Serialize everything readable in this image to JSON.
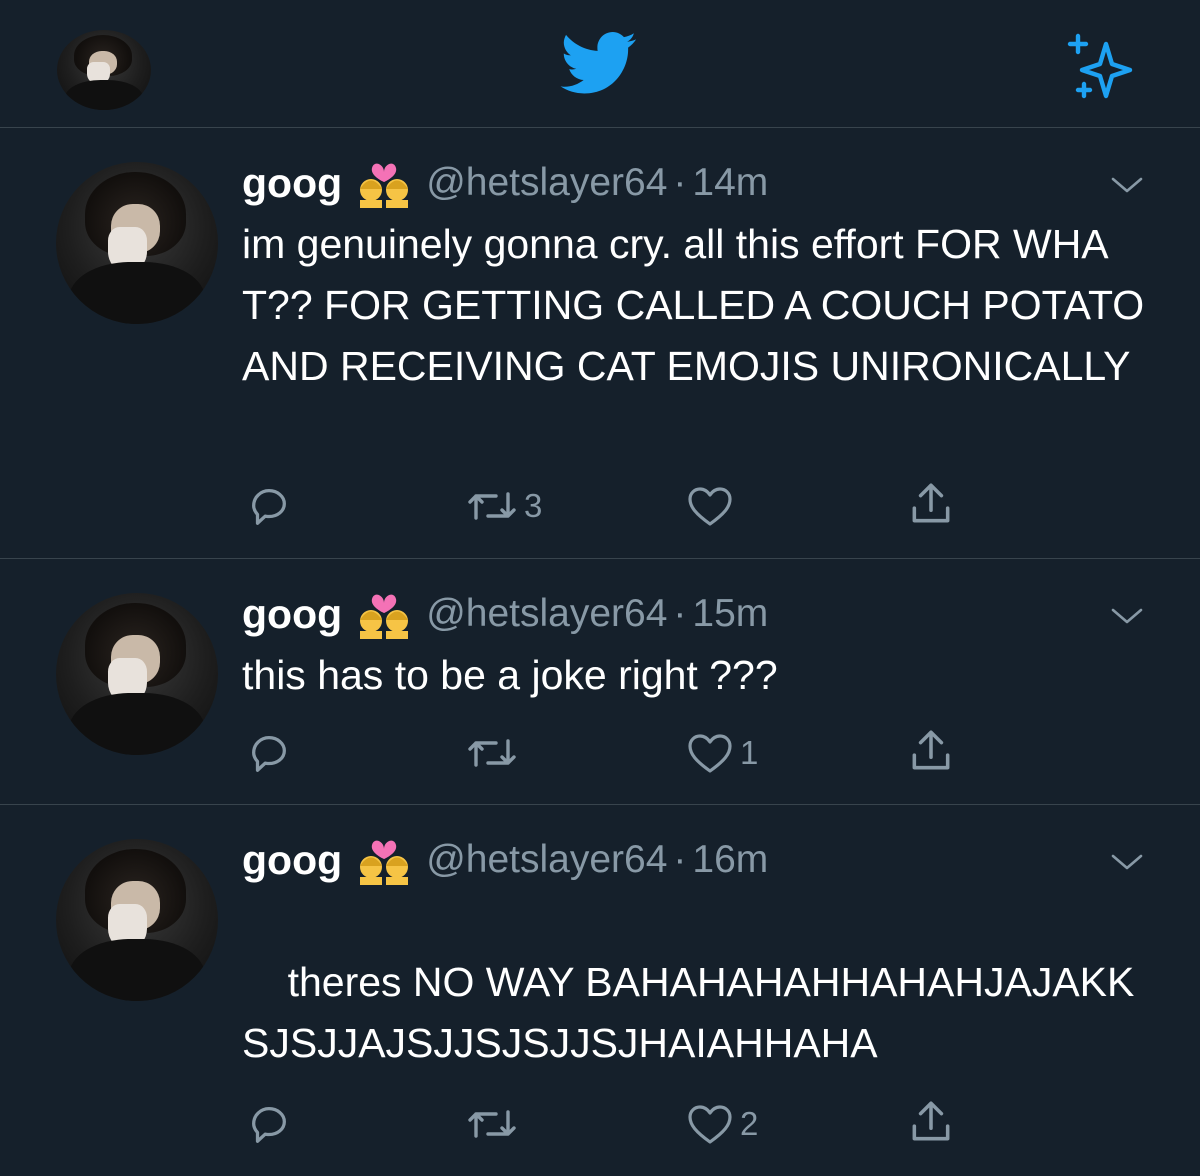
{
  "header": {
    "avatar_icon": "profile-avatar",
    "logo_icon": "twitter-bird-icon",
    "logo_color": "#1da1f2",
    "sparkle_icon": "sparkle-icon"
  },
  "colors": {
    "background": "#15202b",
    "divider": "#38444d",
    "secondary_text": "#8899a6",
    "accent": "#1da1f2"
  },
  "tweets": [
    {
      "name": "goog",
      "emoji_icon": "couple-with-heart-women-emoji",
      "handle": "@hetslayer64",
      "separator": "·",
      "time": "14m",
      "text": "im genuinely gonna cry. all this effort FOR WHAT?? FOR GETTING CALLED A COUCH POTATO AND RECEIVING CAT EMOJIS UNIRONICALLY",
      "reply_count": "",
      "retweet_count": "3",
      "like_count": ""
    },
    {
      "name": "goog",
      "emoji_icon": "couple-with-heart-women-emoji",
      "handle": "@hetslayer64",
      "separator": "·",
      "time": "15m",
      "text": "this has to be a joke right ???",
      "reply_count": "",
      "retweet_count": "",
      "like_count": "1"
    },
    {
      "name": "goog",
      "emoji_icon": "couple-with-heart-women-emoji",
      "handle": "@hetslayer64",
      "separator": "·",
      "time": "16m",
      "text": "theres NO WAY BAHAHAHAHHAHAHJAJAKKSJSJJAJSJJSJSJJSJHAIAHHAHA",
      "reply_count": "",
      "retweet_count": "",
      "like_count": "2"
    }
  ]
}
